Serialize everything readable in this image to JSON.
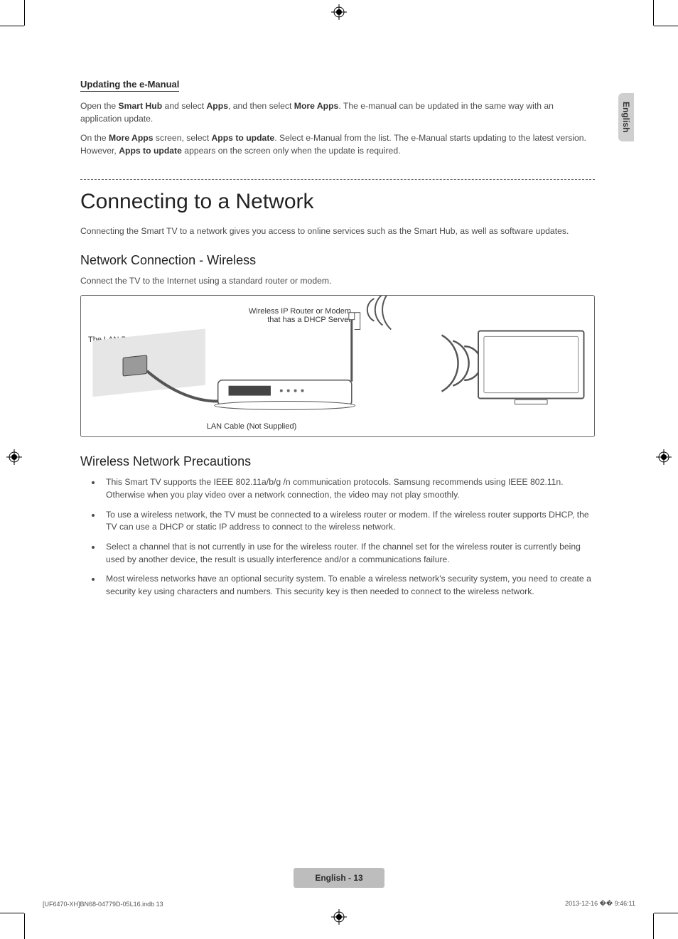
{
  "side_tab": "English",
  "section_updating_title": "Updating the e-Manual",
  "p1_a": "Open the ",
  "p1_b1": "Smart Hub",
  "p1_c": " and select ",
  "p1_b2": "Apps",
  "p1_d": ", and then select ",
  "p1_b3": "More Apps",
  "p1_e": ". The e-manual can be updated in the same way with an application update.",
  "p2_a": "On the ",
  "p2_b1": "More Apps",
  "p2_c": " screen, select ",
  "p2_b2": "Apps to update",
  "p2_d": ". Select e-Manual from the list. The e-Manual starts updating to the latest version. However, ",
  "p2_b3": "Apps to update",
  "p2_e": " appears on the screen only when the update is required.",
  "main_heading": "Connecting to a Network",
  "intro": "Connecting the Smart TV to a network gives you access to online services such as the Smart Hub, as well as software updates.",
  "sub_heading_wireless": "Network Connection - Wireless",
  "wireless_intro": "Connect the TV to the Internet using a standard router or modem.",
  "fig": {
    "router_label_l1": "Wireless IP Router or Modem",
    "router_label_l2": "that has a DHCP Server",
    "lan_port": "The LAN Port on the Wall",
    "lan_cable": "LAN Cable (Not Supplied)"
  },
  "sub_heading_precautions": "Wireless Network Precautions",
  "bullets": [
    "This Smart TV supports the IEEE 802.11a/b/g /n communication protocols. Samsung recommends using IEEE 802.11n. Otherwise when you play video over a network connection, the video may not play smoothly.",
    "To use a wireless network, the TV must be connected to a wireless router or modem. If the wireless router supports DHCP, the TV can use a DHCP or static IP address to connect to the wireless network.",
    "Select a channel that is not currently in use for the wireless router. If the channel set for the wireless router is currently being used by another device, the result is usually interference and/or a communications failure.",
    "Most wireless networks have an optional security system. To enable a wireless network's security system, you need to create a security key using characters and numbers. This security key is then needed to connect to the wireless network."
  ],
  "footer_badge": "English - 13",
  "footer_left": "[UF6470-XH]BN68-04779D-05L16.indb   13",
  "footer_right": "2013-12-16   �� 9:46:11"
}
